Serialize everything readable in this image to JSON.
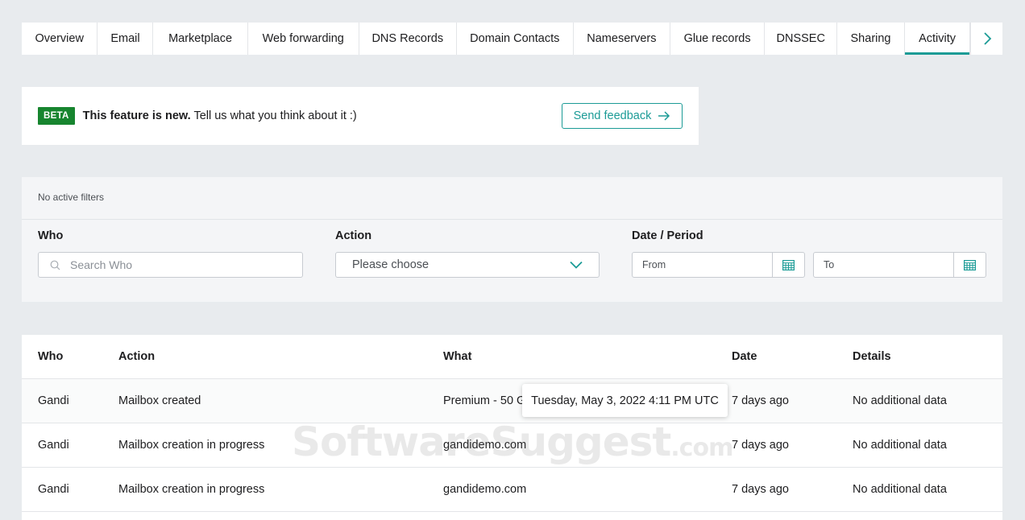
{
  "tabs": [
    {
      "label": "Overview"
    },
    {
      "label": "Email"
    },
    {
      "label": "Marketplace"
    },
    {
      "label": "Web forwarding"
    },
    {
      "label": "DNS Records"
    },
    {
      "label": "Domain Contacts"
    },
    {
      "label": "Nameservers"
    },
    {
      "label": "Glue records"
    },
    {
      "label": "DNSSEC"
    },
    {
      "label": "Sharing"
    },
    {
      "label": "Activity",
      "active": true
    }
  ],
  "banner": {
    "badge": "BETA",
    "bold_text": "This feature is new.",
    "text": " Tell us what you think about it :)",
    "feedback_label": "Send feedback"
  },
  "filters": {
    "status": "No active filters",
    "who_label": "Who",
    "who_placeholder": "Search Who",
    "action_label": "Action",
    "action_selected": "Please choose",
    "date_label": "Date / Period",
    "from_placeholder": "From",
    "to_placeholder": "To"
  },
  "table": {
    "headers": {
      "who": "Who",
      "action": "Action",
      "what": "What",
      "date": "Date",
      "details": "Details"
    },
    "rows": [
      {
        "who": "Gandi",
        "action": "Mailbox created",
        "what": "Premium - 50 GB",
        "date": "7 days ago",
        "details": "No additional data"
      },
      {
        "who": "Gandi",
        "action": "Mailbox creation in progress",
        "what": "gandidemo.com",
        "date": "7 days ago",
        "details": "No additional data"
      },
      {
        "who": "Gandi",
        "action": "Mailbox creation in progress",
        "what": "gandidemo.com",
        "date": "7 days ago",
        "details": "No additional data"
      }
    ]
  },
  "tooltip": {
    "text": "Tuesday, May 3, 2022 4:11 PM UTC"
  },
  "watermark": {
    "main": "SoftwareSuggest",
    "suffix": ".com"
  },
  "colors": {
    "accent": "#1b9b96",
    "beta_green": "#17852f",
    "background": "#e8ebee"
  }
}
